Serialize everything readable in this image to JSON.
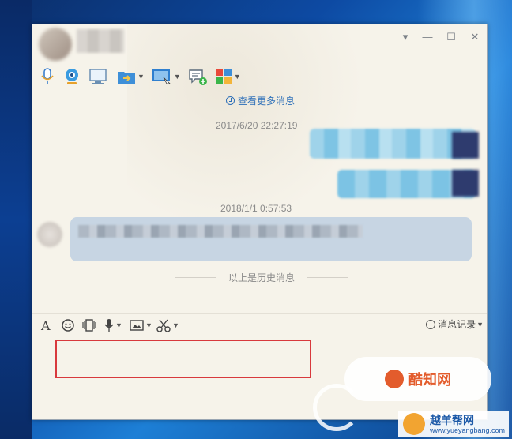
{
  "desktop": {
    "accent": "#0d4aa3"
  },
  "window": {
    "title_bar": {
      "contact_name": "",
      "controls": [
        "▾",
        "—",
        "☐",
        "✕"
      ]
    },
    "toolbar": {
      "items": [
        {
          "icon": "microphone-icon"
        },
        {
          "icon": "webcam-icon"
        },
        {
          "icon": "monitor-icon"
        },
        {
          "icon": "folder-transfer-icon"
        },
        {
          "icon": "remote-desktop-icon"
        },
        {
          "icon": "add-chat-icon"
        },
        {
          "icon": "apps-grid-icon"
        }
      ]
    },
    "chat": {
      "view_more": "查看更多消息",
      "timestamps": [
        "2017/6/20 22:27:19",
        "2018/1/1 0:57:53"
      ],
      "history_divider": "以上是历史消息"
    },
    "input_toolbar": {
      "tools": [
        "font-icon",
        "emoji-icon",
        "shake-icon",
        "voice-icon",
        "image-icon",
        "screenshot-icon"
      ],
      "message_log_label": "消息记录"
    },
    "highlight_color": "#d8393d"
  },
  "watermarks": {
    "site_name": "酷知网",
    "site_name_2": "越羊帮网",
    "site_url": "www.yueyangbang.com"
  }
}
